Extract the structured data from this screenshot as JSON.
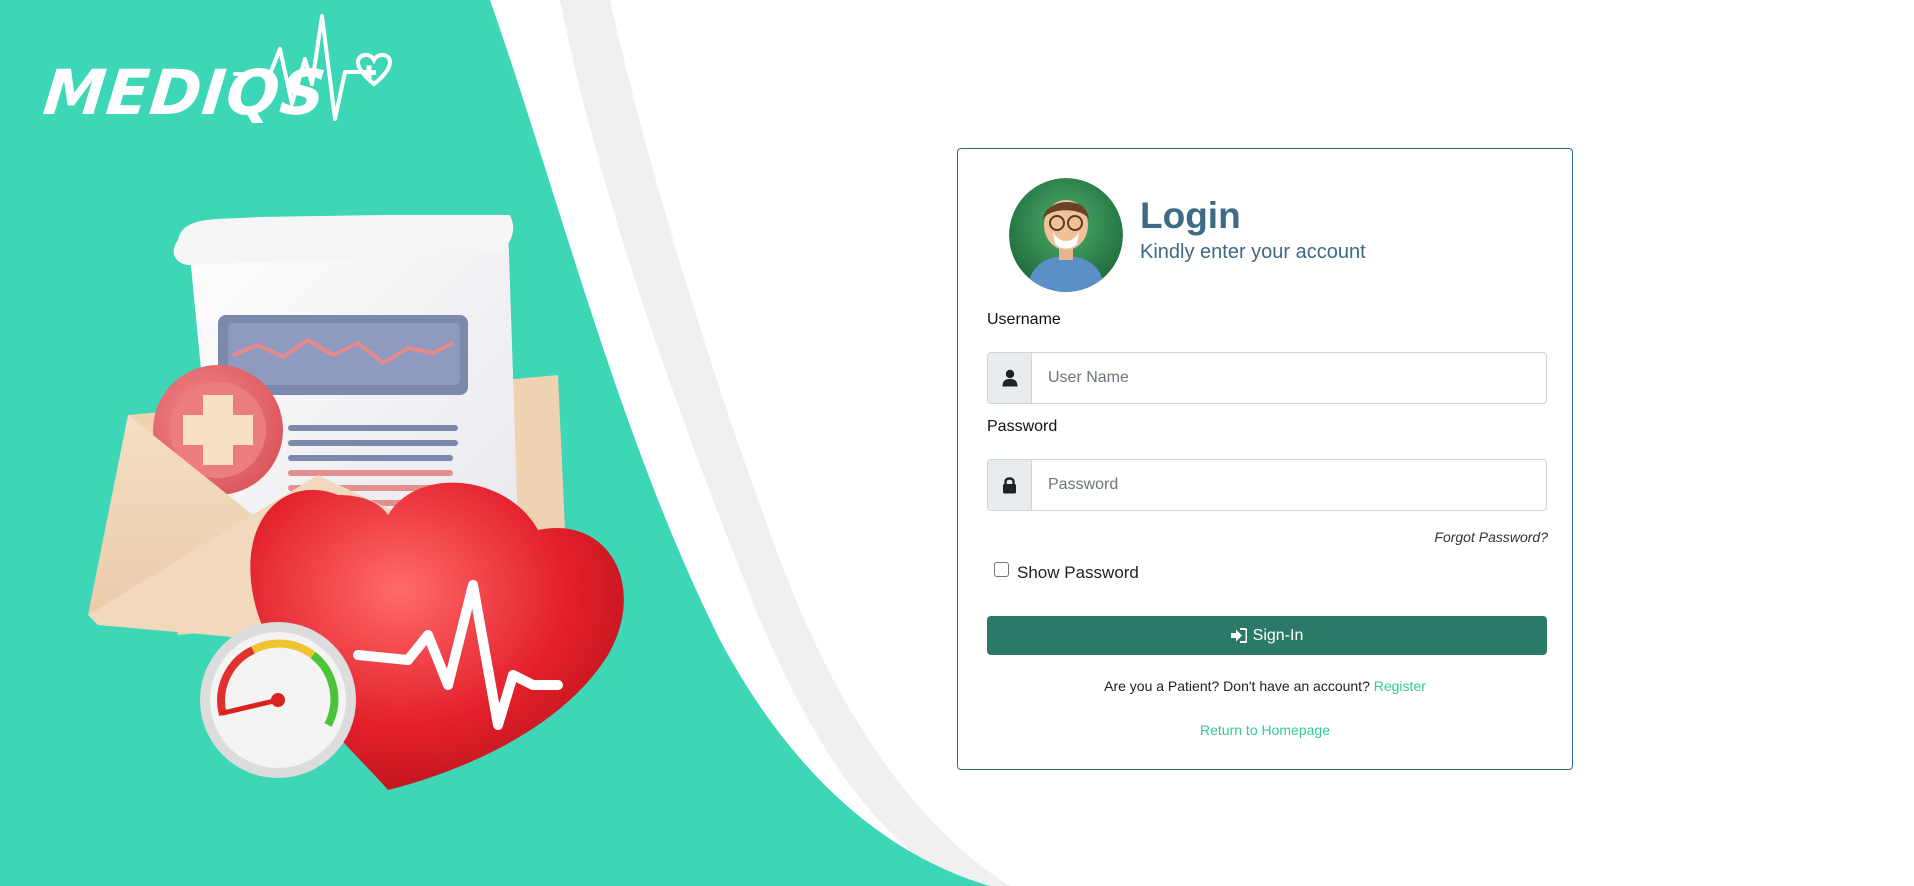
{
  "brand": {
    "name": "MEDIQS",
    "primary_color": "#3dd6b6"
  },
  "login": {
    "title": "Login",
    "subtitle": "Kindly enter your account",
    "username_label": "Username",
    "username_placeholder": "User Name",
    "username_value": "",
    "password_label": "Password",
    "password_placeholder": "Password",
    "password_value": "",
    "forgot_password": "Forgot Password?",
    "show_password_label": "Show Password",
    "show_password_checked": false,
    "signin_label": "Sign-In",
    "register_prompt": "Are you a Patient? Don't have an account?",
    "register_link": "Register",
    "return_link": "Return to Homepage"
  },
  "colors": {
    "accent": "#3dd6b6",
    "button": "#2a7a67",
    "title": "#3d6a84",
    "link": "#2ecc9a",
    "card_border": "#2f6a82"
  },
  "icons": {
    "username": "user-icon",
    "password": "lock-icon",
    "signin": "sign-in-icon",
    "brand": "heartbeat-icon"
  }
}
